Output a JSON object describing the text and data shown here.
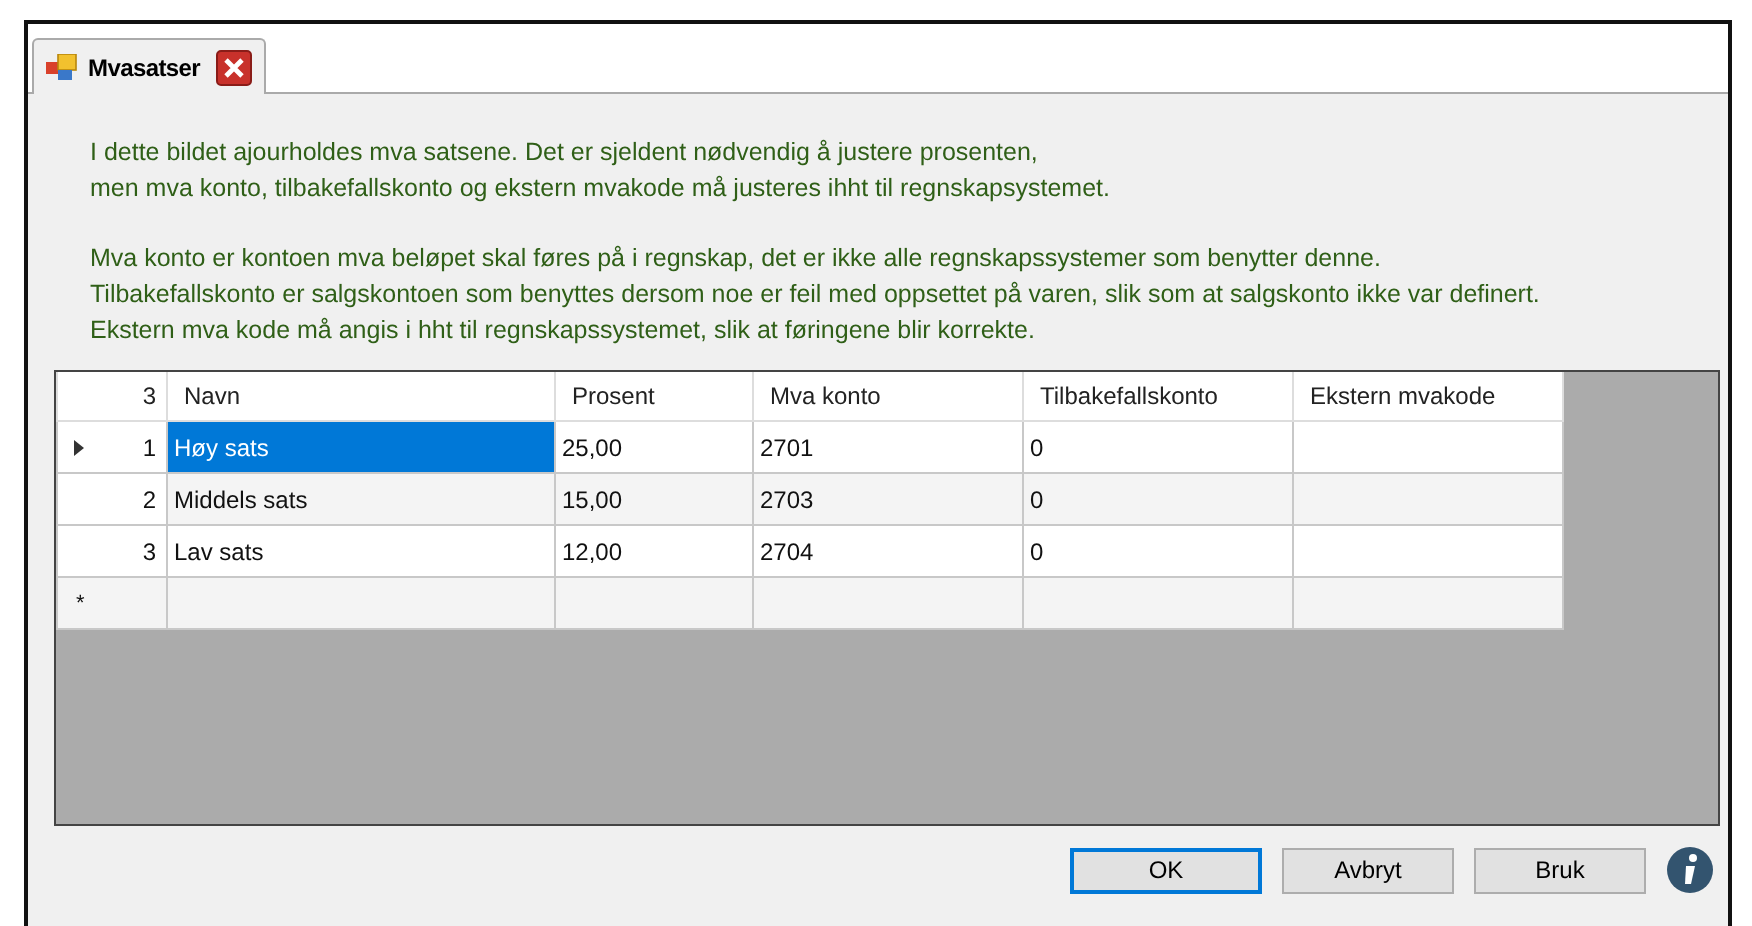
{
  "tab": {
    "title": "Mvasatser",
    "selected": true
  },
  "description": [
    [
      "I dette bildet ajourholdes mva satsene. Det er sjeldent nødvendig å justere prosenten,",
      "men mva konto, tilbakefallskonto og ekstern mvakode må justeres ihht til regnskapsystemet."
    ],
    [
      "Mva konto er kontoen mva beløpet skal føres på i regnskap, det er ikke alle regnskapssystemer som benytter denne.",
      "Tilbakefallskonto er salgskontoen som benyttes dersom noe er feil med oppsettet på varen, slik som at salgskonto ikke var definert.",
      "Ekstern mva kode må angis i hht til regnskapssystemet, slik at føringene blir korrekte."
    ]
  ],
  "table": {
    "row_count": "3",
    "columns": [
      "Navn",
      "Prosent",
      "Mva konto",
      "Tilbakefallskonto",
      "Ekstern mvakode"
    ],
    "rows": [
      {
        "number": "1",
        "current": true,
        "selected": true,
        "cells": [
          "Høy sats",
          "25,00",
          "2701",
          "0",
          ""
        ]
      },
      {
        "number": "2",
        "current": false,
        "selected": false,
        "cells": [
          "Middels sats",
          "15,00",
          "2703",
          "0",
          ""
        ]
      },
      {
        "number": "3",
        "current": false,
        "selected": false,
        "cells": [
          "Lav sats",
          "12,00",
          "2704",
          "0",
          ""
        ]
      }
    ],
    "new_row_marker": "*"
  },
  "buttons": [
    {
      "label": "OK",
      "default": true
    },
    {
      "label": "Avbryt",
      "default": false
    },
    {
      "label": "Bruk",
      "default": false
    }
  ]
}
